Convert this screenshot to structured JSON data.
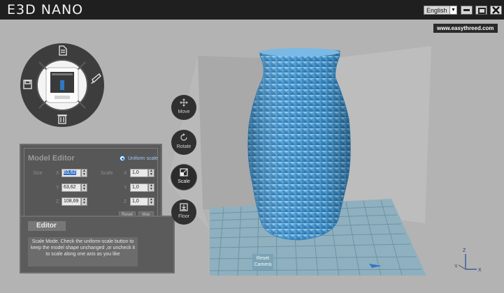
{
  "app": {
    "title": "E3D NANO",
    "language": "English",
    "website": "www.easythreed.com"
  },
  "model_editor": {
    "title": "Model Editor",
    "uniform_scale_label": "Uniform scale",
    "size_label": "Size",
    "scale_label": "Scale",
    "axes": [
      "X",
      "Y",
      "Z"
    ],
    "size_values": [
      "63,62",
      "63,62",
      "108,69"
    ],
    "scale_values": [
      "1,0",
      "1,0",
      "1,0"
    ],
    "reset_label": "Reset",
    "max_label": "Max"
  },
  "editor": {
    "title": "Editor",
    "text": "Scale Mode. Check the uniform-scale button to keep the model shape unchanged ,or uncheck it to scale along one axis as you like"
  },
  "tools": {
    "move": "Move",
    "rotate": "Rotate",
    "scale": "Scale",
    "floor": "Floor"
  },
  "reset_camera": [
    "Reset",
    "Camera"
  ],
  "axis_gizmo": {
    "z": "Z",
    "y": "Y",
    "x": "X"
  },
  "colors": {
    "vase": "#4d9fd6",
    "panel": "#5a5a5a",
    "titlebar": "#1f1f1f",
    "grid": "#5f8fa5",
    "accent": "#2f6dc7"
  }
}
